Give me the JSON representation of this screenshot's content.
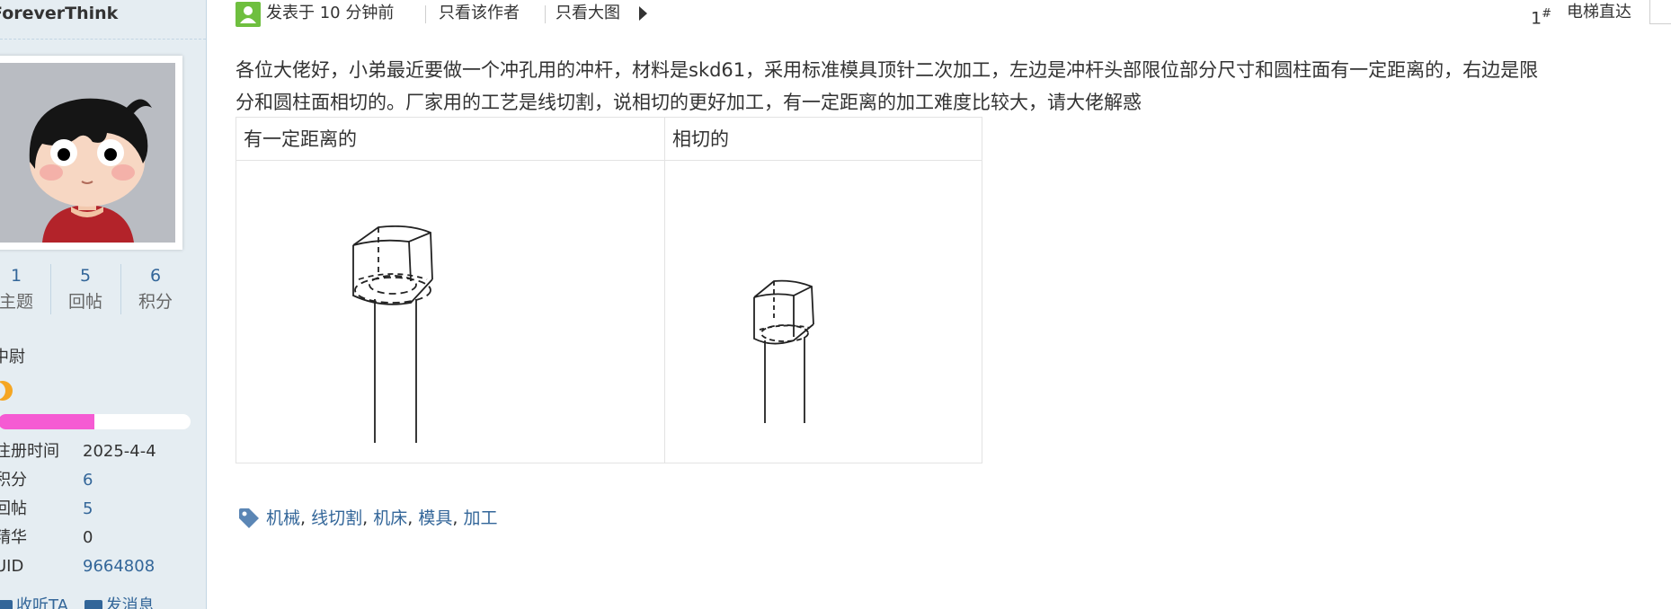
{
  "sidebar": {
    "username": "ForeverThink",
    "avatar_icon": "cartoon-avatar-icon",
    "stats": [
      {
        "value": "1",
        "label": "主题"
      },
      {
        "value": "5",
        "label": "回帖"
      },
      {
        "value": "6",
        "label": "积分"
      }
    ],
    "rank": "中尉",
    "rank_icon": "moon-icon",
    "level_progress_percent": 50,
    "level_color": "#f55bd3",
    "info": [
      {
        "key": "注册时间",
        "value": "2025-4-4"
      },
      {
        "key": "积分",
        "value": "6"
      },
      {
        "key": "回帖",
        "value": "5"
      },
      {
        "key": "精华",
        "value": "0"
      },
      {
        "key": "UID",
        "value": "9664808"
      }
    ],
    "actions": [
      {
        "label": "收听TA",
        "icon": "broadcast-icon"
      },
      {
        "label": "发消息",
        "icon": "mail-icon"
      }
    ]
  },
  "post": {
    "posted_time": "发表于 10 分钟前",
    "only_author": "只看该作者",
    "only_big_image": "只看大图",
    "floor": "1",
    "floor_mark": "#",
    "elevator": "电梯直达",
    "body_line1": "各位大佬好，小弟最近要做一个冲孔用的冲杆，材料是skd61，采用标准模具顶针二次加工，左边是冲杆头部限位部分尺寸和圆柱面有一定距离的，右边是限",
    "body_line2": "分和圆柱面相切的。厂家用的工艺是线切割，说相切的更好加工，有一定距离的加工难度比较大，请大佬解惑",
    "table_headers": [
      "有一定距离的",
      "相切的"
    ],
    "drawing_icons": [
      "punch-with-offset-drawing",
      "punch-tangent-drawing"
    ]
  },
  "tags": {
    "icon": "tag-icon",
    "items": [
      "机械",
      "线切割",
      "机床",
      "模具",
      "加工"
    ]
  },
  "colors": {
    "link": "#336699",
    "sidebar_bg": "#e5edf2",
    "border": "#c2d5e3"
  }
}
